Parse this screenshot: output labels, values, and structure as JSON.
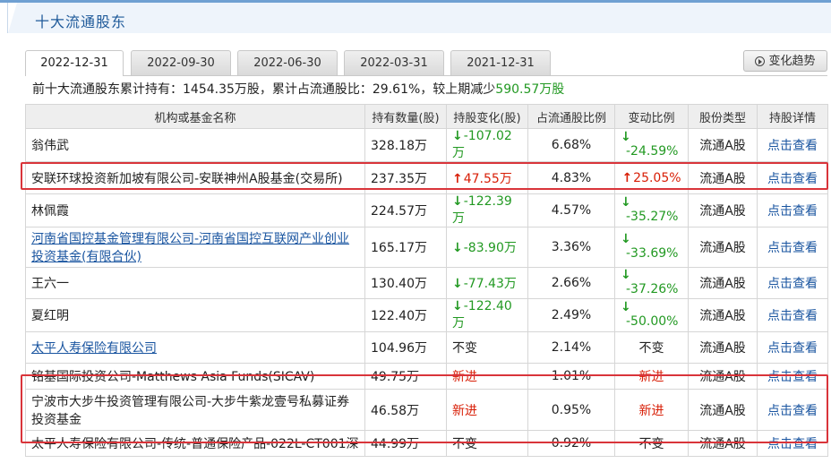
{
  "title": "十大流通股东",
  "tabs": [
    "2022-12-31",
    "2022-09-30",
    "2022-06-30",
    "2022-03-31",
    "2021-12-31"
  ],
  "trend_button": "变化趋势",
  "summary": {
    "prefix": "前十大流通股东累计持有：1454.35万股，累计占流通股比：29.61%，较上期减少",
    "change": "590.57万股"
  },
  "columns": [
    "机构或基金名称",
    "持有数量(股)",
    "持股变化(股)",
    "占流通股比例",
    "变动比例",
    "股份类型",
    "持股详情"
  ],
  "rows": [
    {
      "name": "翁伟武",
      "link": false,
      "qty": "328.18万",
      "chg": "-107.02万",
      "chg_dir": "down",
      "ratio": "6.68%",
      "pct": "-24.59%",
      "pct_dir": "down",
      "type": "流通A股",
      "detail": "点击查看"
    },
    {
      "name": "安联环球投资新加坡有限公司-安联神州A股基金(交易所)",
      "link": false,
      "qty": "237.35万",
      "chg": "47.55万",
      "chg_dir": "up",
      "ratio": "4.83%",
      "pct": "25.05%",
      "pct_dir": "up",
      "type": "流通A股",
      "detail": "点击查看"
    },
    {
      "name": "林佩霞",
      "link": false,
      "qty": "224.57万",
      "chg": "-122.39万",
      "chg_dir": "down",
      "ratio": "4.57%",
      "pct": "-35.27%",
      "pct_dir": "down",
      "type": "流通A股",
      "detail": "点击查看"
    },
    {
      "name": "河南省国控基金管理有限公司-河南省国控互联网产业创业投资基金(有限合伙)",
      "link": true,
      "qty": "165.17万",
      "chg": "-83.90万",
      "chg_dir": "down",
      "ratio": "3.36%",
      "pct": "-33.69%",
      "pct_dir": "down",
      "type": "流通A股",
      "detail": "点击查看"
    },
    {
      "name": "王六一",
      "link": false,
      "qty": "130.40万",
      "chg": "-77.43万",
      "chg_dir": "down",
      "ratio": "2.66%",
      "pct": "-37.26%",
      "pct_dir": "down",
      "type": "流通A股",
      "detail": "点击查看"
    },
    {
      "name": "夏红明",
      "link": false,
      "qty": "122.40万",
      "chg": "-122.40万",
      "chg_dir": "down",
      "ratio": "2.49%",
      "pct": "-50.00%",
      "pct_dir": "down",
      "type": "流通A股",
      "detail": "点击查看"
    },
    {
      "name": "太平人寿保险有限公司",
      "link": true,
      "qty": "104.96万",
      "chg": "不变",
      "chg_dir": "none",
      "ratio": "2.14%",
      "pct": "不变",
      "pct_dir": "none",
      "type": "流通A股",
      "detail": "点击查看"
    },
    {
      "name": "铭基国际投资公司-Matthews Asia Funds(SICAV)",
      "link": false,
      "qty": "49.75万",
      "chg": "新进",
      "chg_dir": "new",
      "ratio": "1.01%",
      "pct": "新进",
      "pct_dir": "new",
      "type": "流通A股",
      "detail": "点击查看"
    },
    {
      "name": "宁波市大步牛投资管理有限公司-大步牛紫龙壹号私募证券投资基金",
      "link": false,
      "qty": "46.58万",
      "chg": "新进",
      "chg_dir": "new",
      "ratio": "0.95%",
      "pct": "新进",
      "pct_dir": "new",
      "type": "流通A股",
      "detail": "点击查看"
    },
    {
      "name": "太平人寿保险有限公司-传统-普通保险产品-022L-CT001深",
      "link": false,
      "qty": "44.99万",
      "chg": "不变",
      "chg_dir": "none",
      "ratio": "0.92%",
      "pct": "不变",
      "pct_dir": "none",
      "type": "流通A股",
      "detail": "点击查看"
    }
  ],
  "colors": {
    "accent": "#1a55a0",
    "up": "#d81e06",
    "down": "#229922",
    "highlight": "#d9343a"
  }
}
